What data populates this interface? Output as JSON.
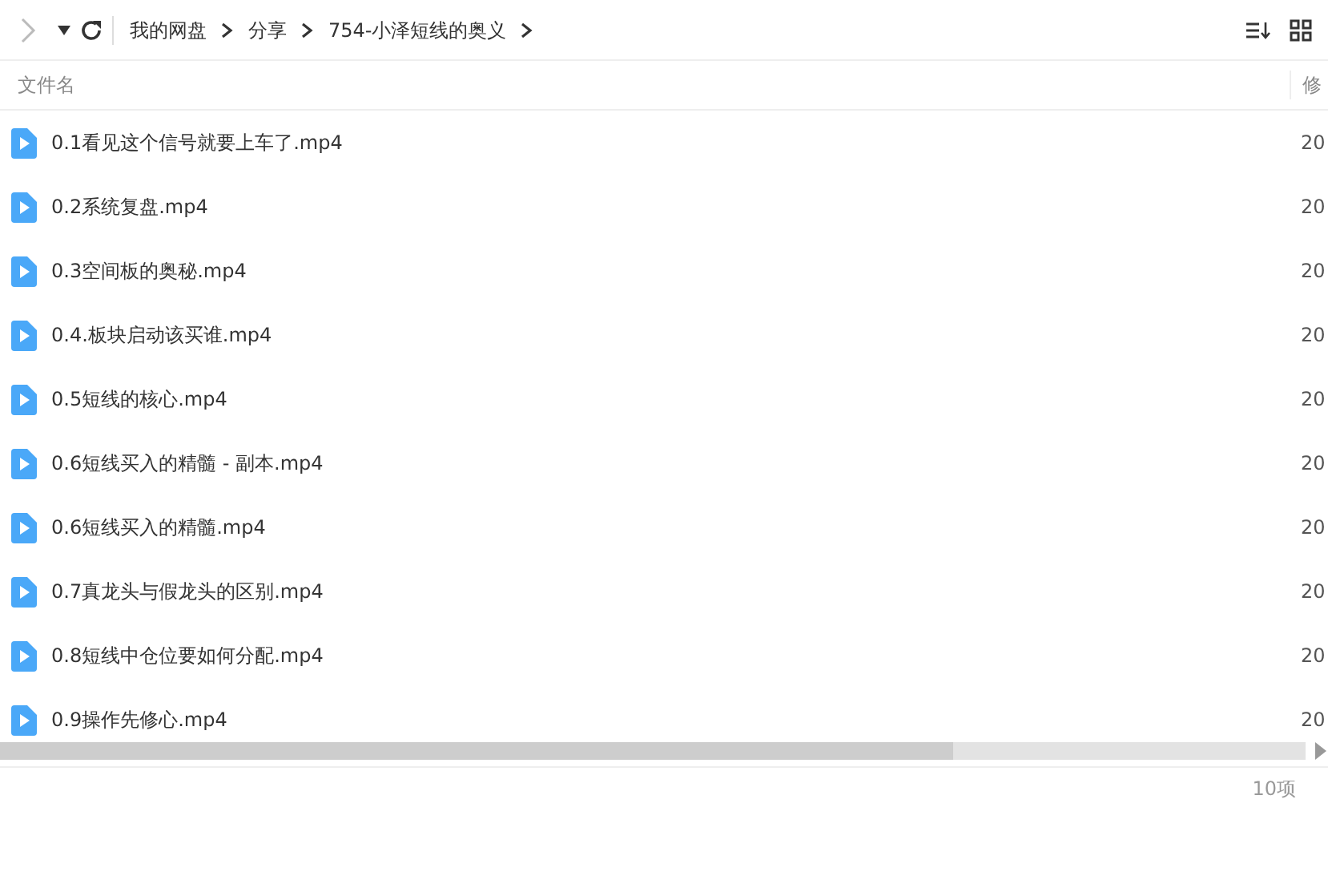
{
  "toolbar": {
    "breadcrumbs": [
      "我的网盘",
      "分享",
      "754-小泽短线的奥义"
    ]
  },
  "table": {
    "columns": [
      "文件名",
      "修"
    ],
    "rows": [
      {
        "name": "0.1看见这个信号就要上车了.mp4",
        "modified": "20"
      },
      {
        "name": "0.2系统复盘.mp4",
        "modified": "20"
      },
      {
        "name": "0.3空间板的奥秘.mp4",
        "modified": "20"
      },
      {
        "name": "0.4.板块启动该买谁.mp4",
        "modified": "20"
      },
      {
        "name": "0.5短线的核心.mp4",
        "modified": "20"
      },
      {
        "name": "0.6短线买入的精髓 - 副本.mp4",
        "modified": "20"
      },
      {
        "name": "0.6短线买入的精髓.mp4",
        "modified": "20"
      },
      {
        "name": "0.7真龙头与假龙头的区别.mp4",
        "modified": "20"
      },
      {
        "name": "0.8短线中仓位要如何分配.mp4",
        "modified": "20"
      },
      {
        "name": "0.9操作先修心.mp4",
        "modified": "20"
      }
    ]
  },
  "status_bar": {
    "count": "10项"
  }
}
